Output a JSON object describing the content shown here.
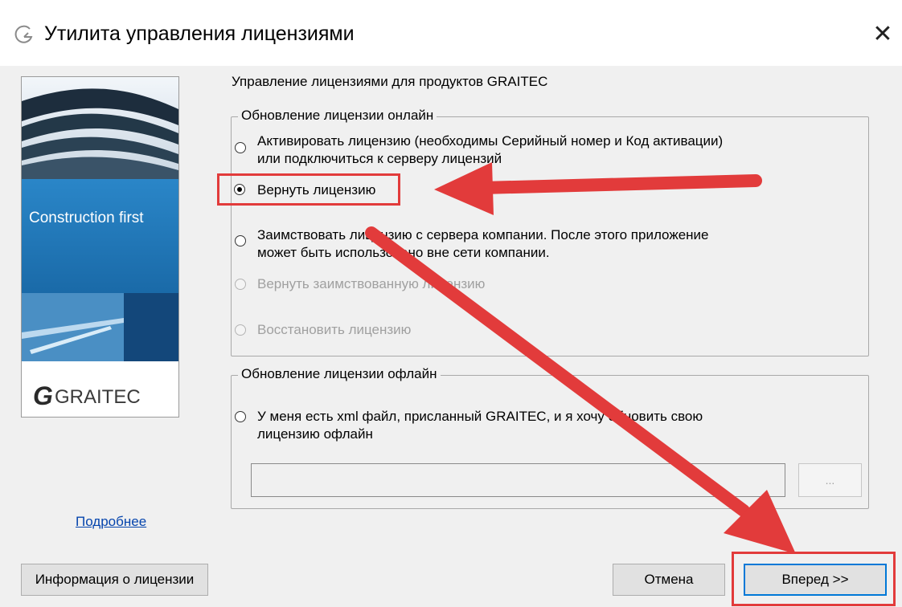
{
  "window": {
    "title": "Утилита управления лицензиями",
    "close_icon": "close-icon"
  },
  "sidebar": {
    "banner_text": "Construction first",
    "logo_text": "GRAITEC",
    "logo_icon": "graitec-logo-icon",
    "more_link": "Подробнее"
  },
  "main": {
    "heading": "Управление лицензиями для продуктов GRAITEC",
    "online": {
      "legend": "Обновление лицензии онлайн",
      "options": [
        {
          "label_line1": "Активировать лицензию (необходимы Серийный номер и Код активации)",
          "label_line2": "или подключиться к серверу лицензий",
          "checked": false,
          "enabled": true
        },
        {
          "label_line1": "Вернуть лицензию",
          "checked": true,
          "enabled": true
        },
        {
          "label_line1": "Заимствовать лицензию с сервера компании. После этого приложение",
          "label_line2": "может быть использовано вне сети компании.",
          "checked": false,
          "enabled": true
        },
        {
          "label_line1": "Вернуть заимствованную лицензию",
          "checked": false,
          "enabled": false
        },
        {
          "label_line1": "Восстановить лицензию",
          "checked": false,
          "enabled": false
        }
      ]
    },
    "offline": {
      "legend": "Обновление лицензии офлайн",
      "option": {
        "label_line1": "У меня есть xml файл, присланный GRAITEC, и я хочу обновить свою",
        "label_line2": "лицензию офлайн",
        "checked": false
      },
      "file_path_value": "",
      "browse_label": "..."
    }
  },
  "footer": {
    "license_info_button": "Информация о лицензии",
    "cancel_button": "Отмена",
    "next_button": "Вперед >>"
  },
  "colors": {
    "annotation_red": "#e23b3b",
    "window_bg": "#f0f0f0",
    "link_blue": "#0645ad"
  }
}
